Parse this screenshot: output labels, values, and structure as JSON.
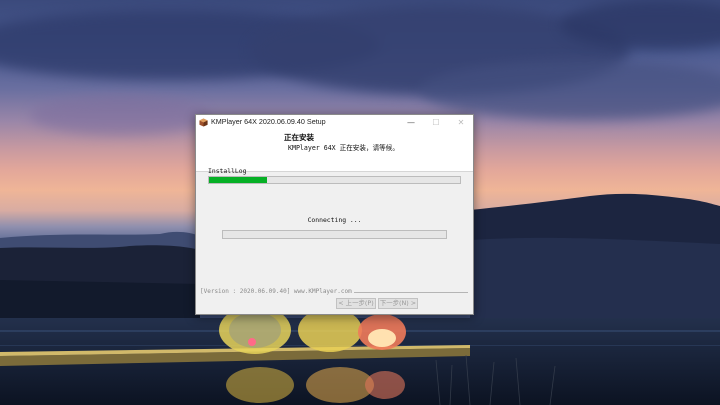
{
  "window": {
    "title": "KMPlayer 64X 2020.06.09.40 Setup",
    "controls": {
      "minimize": "—",
      "maximize": "☐",
      "close": "✕"
    }
  },
  "header": {
    "title": "正在安装",
    "subtitle": "KMPlayer 64X 正在安装，请等候。"
  },
  "install": {
    "log_label": "InstallLog",
    "main_progress": 0.23,
    "status": "Connecting ...",
    "sub_progress": 0
  },
  "footer": {
    "version": "[Version : 2020.06.09.40]  www.KMPlayer.com",
    "back_label": "< 上一步(P)",
    "next_label": "下一步(N) >"
  },
  "colors": {
    "progress_fill": "#06b025",
    "window_bg": "#f0f0f0",
    "disabled_text": "#9a9a9a"
  },
  "icons": {
    "app": "kmplayer-cube-icon"
  }
}
